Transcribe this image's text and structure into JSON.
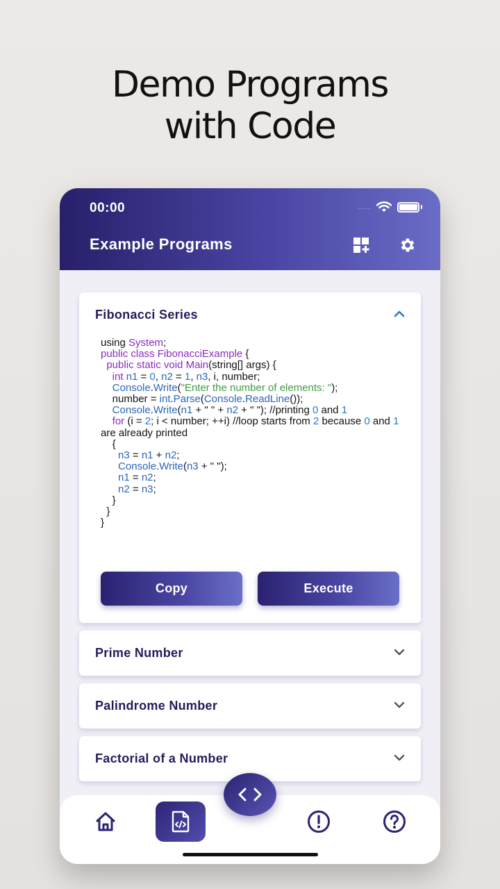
{
  "headline": {
    "line1": "Demo Programs",
    "line2": "with Code"
  },
  "status_bar": {
    "time": "00:00",
    "dots": "....."
  },
  "app_bar": {
    "title": "Example Programs"
  },
  "programs": [
    {
      "title": "Fibonacci Series",
      "expanded": true
    },
    {
      "title": "Prime Number",
      "expanded": false
    },
    {
      "title": "Palindrome Number",
      "expanded": false
    },
    {
      "title": "Factorial of a Number",
      "expanded": false
    }
  ],
  "code_lines": [
    [
      {
        "t": "using "
      },
      {
        "t": "System",
        "c": "kw"
      },
      {
        "t": ";"
      }
    ],
    [
      {
        "t": "public class ",
        "c": "kw"
      },
      {
        "t": "FibonacciExample",
        "c": "kw"
      },
      {
        "t": " {"
      }
    ],
    [
      {
        "t": "  public static void ",
        "c": "kw"
      },
      {
        "t": "Main",
        "c": "kw"
      },
      {
        "t": "(string[] args) {"
      }
    ],
    [
      {
        "t": "    int ",
        "c": "kw"
      },
      {
        "t": "n1",
        "c": "ty"
      },
      {
        "t": " = "
      },
      {
        "t": "0",
        "c": "num"
      },
      {
        "t": ", "
      },
      {
        "t": "n2",
        "c": "ty"
      },
      {
        "t": " = "
      },
      {
        "t": "1",
        "c": "num"
      },
      {
        "t": ", "
      },
      {
        "t": "n3",
        "c": "ty"
      },
      {
        "t": ", i, number;"
      }
    ],
    [
      {
        "t": "    "
      },
      {
        "t": "Console",
        "c": "ty"
      },
      {
        "t": "."
      },
      {
        "t": "Write",
        "c": "ty"
      },
      {
        "t": "("
      },
      {
        "t": "\"Enter the number of elements: \"",
        "c": "str"
      },
      {
        "t": ");"
      }
    ],
    [
      {
        "t": "    number = "
      },
      {
        "t": "int",
        "c": "ty"
      },
      {
        "t": "."
      },
      {
        "t": "Parse",
        "c": "ty"
      },
      {
        "t": "("
      },
      {
        "t": "Console",
        "c": "ty"
      },
      {
        "t": "."
      },
      {
        "t": "ReadLine",
        "c": "ty"
      },
      {
        "t": "());"
      }
    ],
    [
      {
        "t": "    "
      },
      {
        "t": "Console",
        "c": "ty"
      },
      {
        "t": "."
      },
      {
        "t": "Write",
        "c": "ty"
      },
      {
        "t": "("
      },
      {
        "t": "n1",
        "c": "ty"
      },
      {
        "t": " + \" \" + "
      },
      {
        "t": "n2",
        "c": "ty"
      },
      {
        "t": " + \" \"); //printing "
      },
      {
        "t": "0",
        "c": "num"
      },
      {
        "t": " and "
      },
      {
        "t": "1",
        "c": "num"
      }
    ],
    [
      {
        "t": "    "
      },
      {
        "t": "for",
        "c": "kw"
      },
      {
        "t": " (i = "
      },
      {
        "t": "2",
        "c": "num"
      },
      {
        "t": "; i < number; ++i) //loop starts from "
      },
      {
        "t": "2",
        "c": "num"
      },
      {
        "t": " because "
      },
      {
        "t": "0",
        "c": "num"
      },
      {
        "t": " and "
      },
      {
        "t": "1",
        "c": "num"
      },
      {
        "t": " are already printed"
      }
    ],
    [
      {
        "t": "    {"
      }
    ],
    [
      {
        "t": "      "
      },
      {
        "t": "n3",
        "c": "ty"
      },
      {
        "t": " = "
      },
      {
        "t": "n1",
        "c": "ty"
      },
      {
        "t": " + "
      },
      {
        "t": "n2",
        "c": "ty"
      },
      {
        "t": ";"
      }
    ],
    [
      {
        "t": "      "
      },
      {
        "t": "Console",
        "c": "ty"
      },
      {
        "t": "."
      },
      {
        "t": "Write",
        "c": "ty"
      },
      {
        "t": "("
      },
      {
        "t": "n3",
        "c": "ty"
      },
      {
        "t": " + \" \");"
      }
    ],
    [
      {
        "t": "      "
      },
      {
        "t": "n1",
        "c": "ty"
      },
      {
        "t": " = "
      },
      {
        "t": "n2",
        "c": "ty"
      },
      {
        "t": ";"
      }
    ],
    [
      {
        "t": "      "
      },
      {
        "t": "n2",
        "c": "ty"
      },
      {
        "t": " = "
      },
      {
        "t": "n3",
        "c": "ty"
      },
      {
        "t": ";"
      }
    ],
    [
      {
        "t": "    }"
      }
    ],
    [
      {
        "t": "  }"
      }
    ],
    [
      {
        "t": "}"
      }
    ]
  ],
  "buttons": {
    "copy": "Copy",
    "execute": "Execute"
  },
  "fab": {
    "icon": "code-brackets-icon"
  },
  "nav": [
    "home-icon",
    "code-file-icon",
    "alert-circle-icon",
    "help-circle-icon"
  ],
  "colors": {
    "primary_dark": "#28206a",
    "primary_light": "#6a6cc6",
    "card_title": "#231c5c",
    "keyword": "#8c2bbf",
    "type": "#2b66b7",
    "string": "#3f9b43",
    "number": "#2b77c9"
  }
}
